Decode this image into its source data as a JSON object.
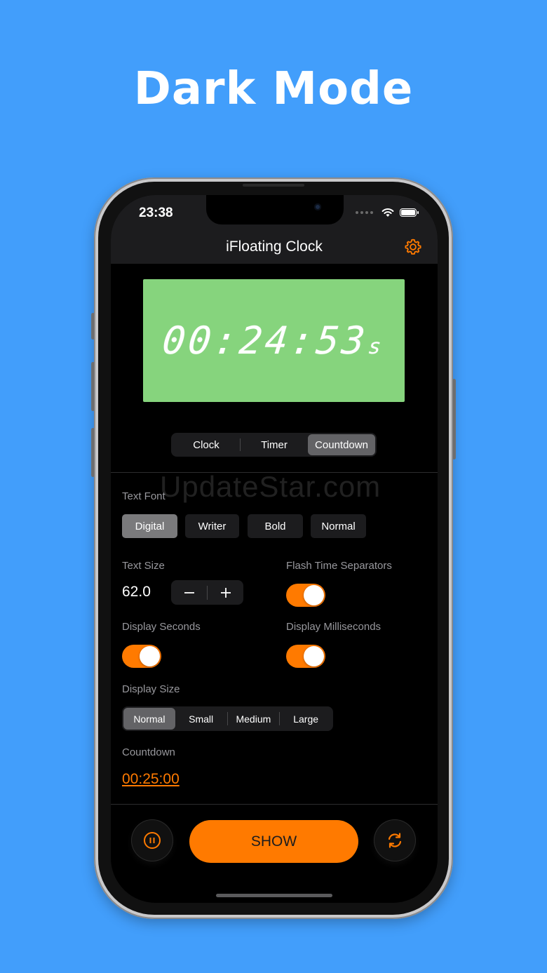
{
  "headline": "Dark Mode",
  "status": {
    "time": "23:38"
  },
  "nav": {
    "title": "iFloating Clock",
    "settings_icon": "gear-icon"
  },
  "display": {
    "time": "00:24:53",
    "unit": "s",
    "background": "#86d47d"
  },
  "mode_tabs": [
    {
      "label": "Clock",
      "selected": false
    },
    {
      "label": "Timer",
      "selected": false
    },
    {
      "label": "Countdown",
      "selected": true
    }
  ],
  "watermark": "UpdateStar.com",
  "text_font": {
    "label": "Text Font",
    "options": [
      {
        "label": "Digital",
        "selected": true
      },
      {
        "label": "Writer",
        "selected": false
      },
      {
        "label": "Bold",
        "selected": false
      },
      {
        "label": "Normal",
        "selected": false
      }
    ]
  },
  "text_size": {
    "label": "Text Size",
    "value": "62.0",
    "minus": "−",
    "plus": "+"
  },
  "flash_separators": {
    "label": "Flash Time Separators",
    "on": true
  },
  "display_seconds": {
    "label": "Display Seconds",
    "on": true
  },
  "display_milliseconds": {
    "label": "Display Milliseconds",
    "on": true
  },
  "display_size": {
    "label": "Display Size",
    "options": [
      {
        "label": "Normal",
        "selected": true
      },
      {
        "label": "Small",
        "selected": false
      },
      {
        "label": "Medium",
        "selected": false
      },
      {
        "label": "Large",
        "selected": false
      }
    ]
  },
  "countdown": {
    "label": "Countdown",
    "value": "00:25:00"
  },
  "actions": {
    "show_label": "SHOW",
    "pause_icon": "pause-icon",
    "reset_icon": "refresh-icon"
  },
  "colors": {
    "accent": "#ff7a00",
    "page_bg": "#429efb"
  }
}
